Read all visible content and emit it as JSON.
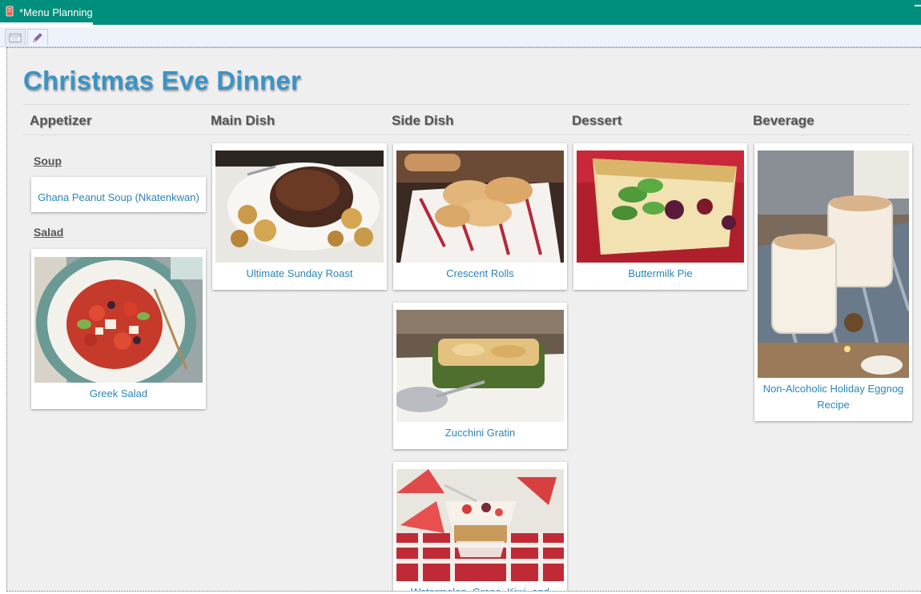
{
  "window": {
    "tab_title": "*Menu Planning"
  },
  "page": {
    "title": "Christmas Eve Dinner"
  },
  "columns": [
    "Appetizer",
    "Main Dish",
    "Side Dish",
    "Dessert",
    "Beverage"
  ],
  "appetizer": {
    "soup_heading": "Soup",
    "soup_item": "Ghana Peanut Soup (Nkatenkwan)",
    "salad_heading": "Salad",
    "salad_item": "Greek Salad"
  },
  "main_dish": {
    "item1": "Ultimate Sunday Roast"
  },
  "side_dish": {
    "item1": "Crescent Rolls",
    "item2": "Zucchini Gratin",
    "item3": "Watermelon, Grape, Kiwi, and"
  },
  "dessert": {
    "item1": "Buttermilk Pie"
  },
  "beverage": {
    "item1": "Non-Alcoholic Holiday Eggnog Recipe"
  },
  "colors": {
    "titlebar": "#008f7d",
    "accent": "#3c93c3",
    "link": "#2b85b8"
  },
  "icons": [
    "recipe-book-icon",
    "form-view-icon",
    "edit-pencil-icon"
  ]
}
